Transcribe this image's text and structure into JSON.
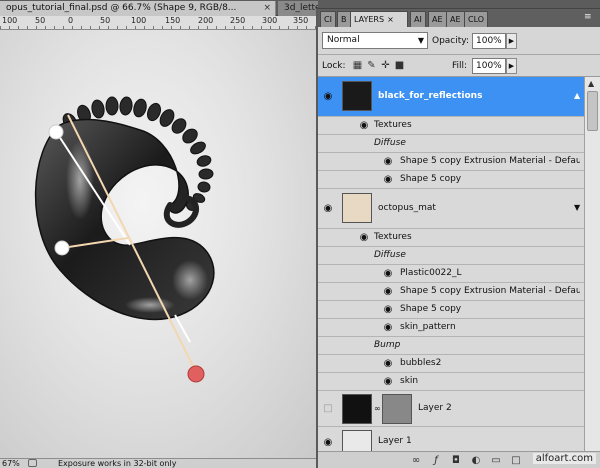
{
  "document": {
    "tab_active": "opus_tutorial_final.psd @ 66.7% (Shape 9, RGB/8...",
    "tab_inactive": "3d_lette"
  },
  "ruler": {
    "labels": [
      "100",
      "50",
      "0",
      "50",
      "100",
      "150",
      "200",
      "250",
      "300",
      "350"
    ]
  },
  "status": {
    "zoom": "67%",
    "message": "Exposure works in 32-bit only"
  },
  "panel": {
    "tabs": [
      "CI",
      "B",
      "LAYERS",
      "AI",
      "AE",
      "AE",
      "CLO"
    ],
    "blend_mode": "Normal",
    "opacity_label": "Opacity:",
    "opacity_value": "100%",
    "lock_label": "Lock:",
    "fill_label": "Fill:",
    "fill_value": "100%",
    "layers": [
      {
        "name": "black_for_reflections",
        "selected": true,
        "textures_label": "Textures",
        "diffuse_label": "Diffuse",
        "items": [
          "Shape 5 copy Extrusion Material - Default ...",
          "Shape 5 copy"
        ]
      },
      {
        "name": "octopus_mat",
        "selected": false,
        "textures_label": "Textures",
        "diffuse_label": "Diffuse",
        "items": [
          "Plastic0022_L",
          "Shape 5 copy Extrusion Material - Default ...",
          "Shape 5 copy",
          "skin_pattern"
        ],
        "bump_label": "Bump",
        "bump_items": [
          "bubbles2",
          "skin"
        ]
      },
      {
        "name": "Layer 2"
      },
      {
        "name": "Layer 1"
      }
    ],
    "footer_icons": [
      "link-icon",
      "fx-icon",
      "mask-icon",
      "adjustment-icon",
      "folder-icon",
      "new-layer-icon",
      "trash-icon"
    ],
    "watermark": "alfoart.com"
  },
  "colors": {
    "selection": "#3d91f2",
    "panel_bg": "#d6d6d6",
    "canvas_bg": "#e3e3e3"
  }
}
